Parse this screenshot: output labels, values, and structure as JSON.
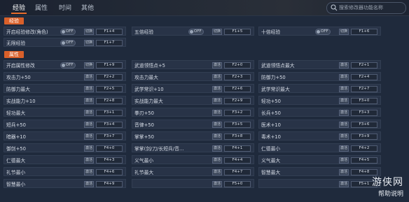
{
  "tabs": [
    "经验",
    "属性",
    "时间",
    "其他"
  ],
  "search": {
    "placeholder": "搜索修改器功能名称"
  },
  "sections": {
    "exp": "经验",
    "attr": "属性"
  },
  "common": {
    "toggle_off": "OFF",
    "activate_small": "切换",
    "activate": "激活"
  },
  "exp_rows": [
    {
      "label": "开启经验修改(角色)",
      "key": "F1+4"
    },
    {
      "label": "五倍经验",
      "key": "F1+5"
    },
    {
      "label": "十倍经验",
      "key": "F1+6"
    },
    {
      "label": "无限经验",
      "key": "F1+7"
    }
  ],
  "attr_rows": [
    {
      "label": "开启属性修改",
      "key": "F1+9"
    },
    {
      "label": "武道领悟点+5",
      "key": "F2+0"
    },
    {
      "label": "武道领悟点最大",
      "key": "F2+1"
    },
    {
      "label": "攻击力+50",
      "key": "F2+2"
    },
    {
      "label": "攻击力最大",
      "key": "F2+3"
    },
    {
      "label": "防御力+50",
      "key": "F2+4"
    },
    {
      "label": "防御力最大",
      "key": "F2+5"
    },
    {
      "label": "武学常识+10",
      "key": "F2+6"
    },
    {
      "label": "武学常识最大",
      "key": "F2+7"
    },
    {
      "label": "实战能力+10",
      "key": "F2+8"
    },
    {
      "label": "实战能力最大",
      "key": "F2+9"
    },
    {
      "label": "轻功+50",
      "key": "F3+0"
    },
    {
      "label": "轻功最大",
      "key": "F3+1"
    },
    {
      "label": "拳刃+50",
      "key": "F3+2"
    },
    {
      "label": "长兵+50",
      "key": "F3+3"
    },
    {
      "label": "短兵+50",
      "key": "F3+4"
    },
    {
      "label": "音律+50",
      "key": "F3+5"
    },
    {
      "label": "医术+10",
      "key": "F3+6"
    },
    {
      "label": "暗器+10",
      "key": "F3+7"
    },
    {
      "label": "掌掌+50",
      "key": "F3+8"
    },
    {
      "label": "毒术+10",
      "key": "F3+9"
    },
    {
      "label": "御剑+50",
      "key": "F4+0"
    },
    {
      "label": "掌掌(剑/刀/长短兵/音...",
      "key": "F4+1"
    },
    {
      "label": "仁德最小",
      "key": "F4+2"
    },
    {
      "label": "仁德最大",
      "key": "F4+3"
    },
    {
      "label": "义气最小",
      "key": "F4+4"
    },
    {
      "label": "义气最大",
      "key": "F4+5"
    },
    {
      "label": "礼节最小",
      "key": "F4+6"
    },
    {
      "label": "礼节最大",
      "key": "F4+7"
    },
    {
      "label": "智慧最大",
      "key": "F4+8"
    },
    {
      "label": "智慧最小",
      "key": "F4+9"
    },
    {
      "label": "",
      "key": "F5+0"
    },
    {
      "label": "",
      "key": "F5+1"
    }
  ],
  "watermark": {
    "logo": "游侠网",
    "sub": "帮助说明"
  }
}
